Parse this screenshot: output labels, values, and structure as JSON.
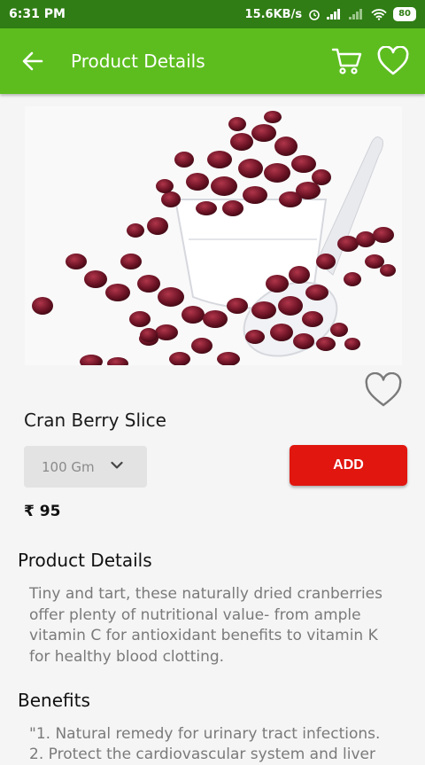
{
  "status_bar": {
    "time": "6:31 PM",
    "network_speed": "15.6KB/s",
    "battery": "80"
  },
  "app_bar": {
    "title": "Product Details",
    "back_icon": "arrow-left-icon",
    "cart_icon": "cart-icon",
    "wishlist_icon": "heart-outline-icon"
  },
  "product": {
    "name": "Cran Berry Slice",
    "weight_option": "100 Gm",
    "add_label": "ADD",
    "price": "₹ 95"
  },
  "details": {
    "title": "Product Details",
    "description": "Tiny and tart, these naturally dried cranberries offer plenty of nutritional value- from ample vitamin C for antioxidant benefits to vitamin K for healthy blood clotting."
  },
  "benefits": {
    "title": "Benefits",
    "line1": "\"1. Natural remedy for urinary tract infections.",
    "line2": "2. Protect the cardiovascular system and liver"
  },
  "colors": {
    "status_bar": "#2f7d14",
    "app_bar": "#5dbd1f",
    "add_button": "#e0160f"
  }
}
